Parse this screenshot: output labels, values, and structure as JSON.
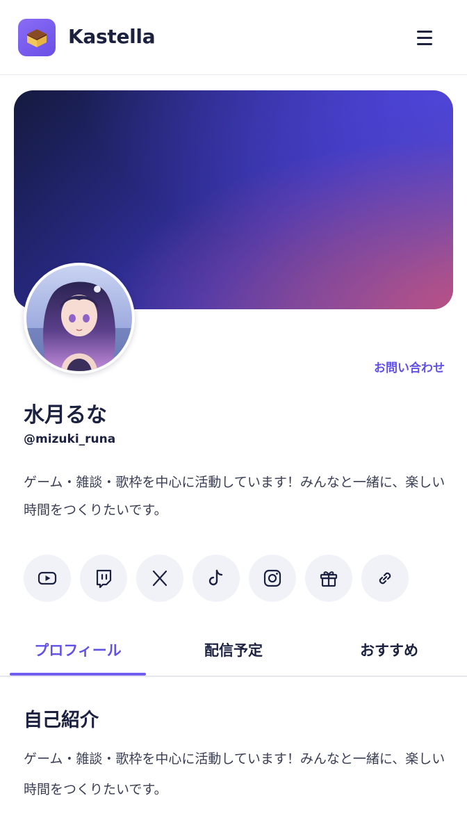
{
  "header": {
    "app_name": "Kastella",
    "menu_icon": "hamburger-menu-icon"
  },
  "profile": {
    "contact_label": "お問い合わせ",
    "display_name": "水月るな",
    "handle": "@mizuki_runa",
    "bio": "ゲーム・雑談・歌枠を中心に活動しています！みんなと一緒に、楽しい時間をつくりたいです。"
  },
  "socials": [
    {
      "name": "youtube-icon"
    },
    {
      "name": "twitch-icon"
    },
    {
      "name": "x-icon"
    },
    {
      "name": "tiktok-icon"
    },
    {
      "name": "instagram-icon"
    },
    {
      "name": "gift-icon"
    },
    {
      "name": "link-icon"
    }
  ],
  "tabs": [
    {
      "label": "プロフィール",
      "active": true
    },
    {
      "label": "配信予定",
      "active": false
    },
    {
      "label": "おすすめ",
      "active": false
    }
  ],
  "about": {
    "title": "自己紹介",
    "body": "ゲーム・雑談・歌枠を中心に活動しています！みんなと一緒に、楽しい時間をつくりたいです。"
  },
  "colors": {
    "accent": "#6151e6",
    "text": "#1c2140",
    "icon_bg": "#f1f2f7"
  }
}
